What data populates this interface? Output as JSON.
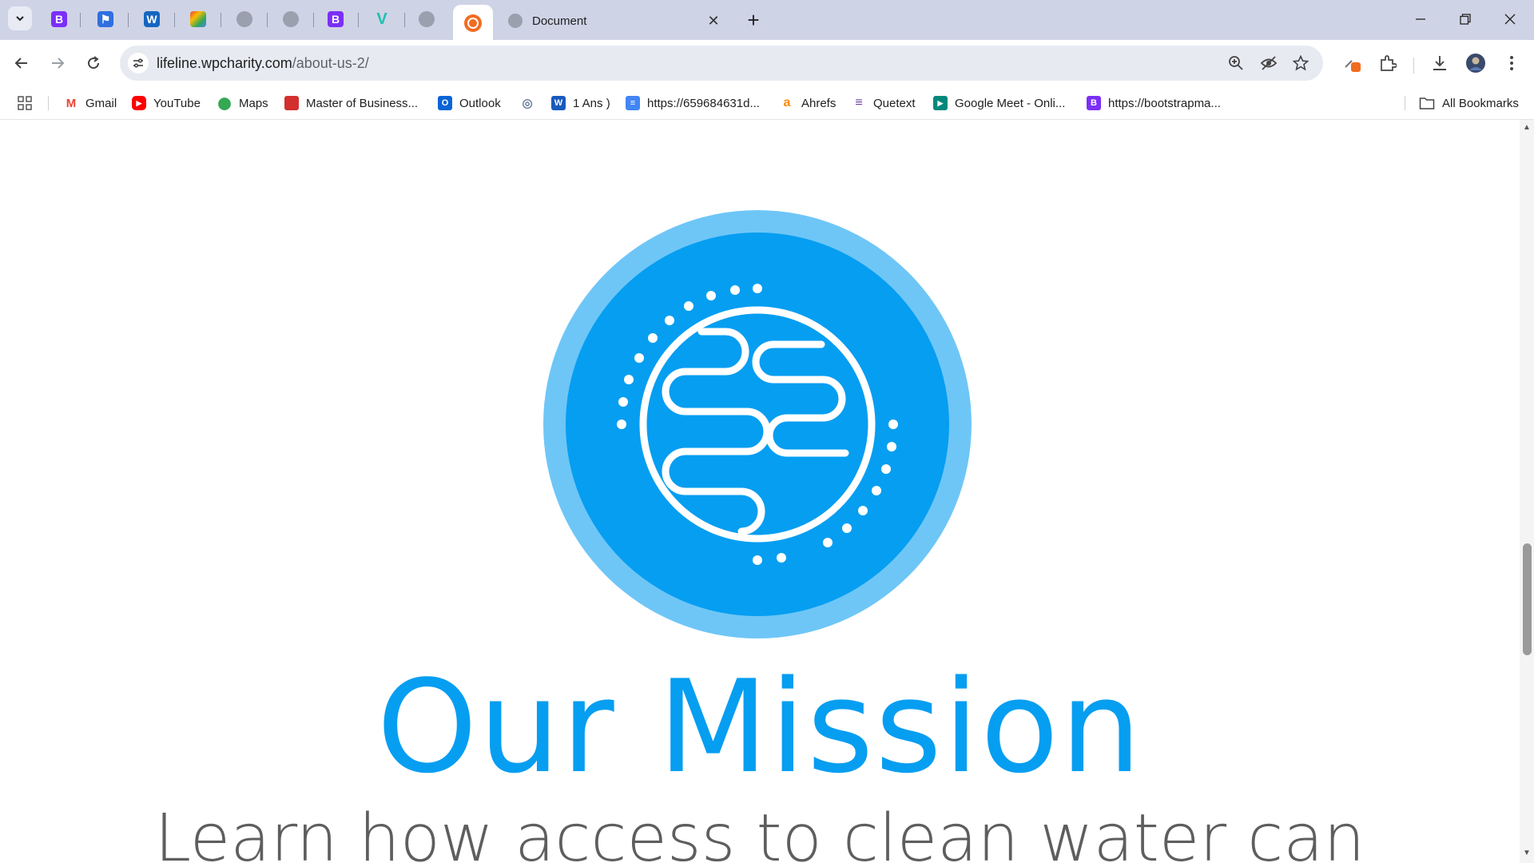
{
  "browser": {
    "tabs": [
      {
        "icon": "bootstrap-icon",
        "letter": "B",
        "color": "#7b2ff7"
      },
      {
        "icon": "flag-icon",
        "letter": "⚑",
        "color": "#2f6fe0"
      },
      {
        "icon": "w-app-icon",
        "letter": "W",
        "color": "#1565c0"
      },
      {
        "icon": "puzzle-color-icon",
        "letter": "✱",
        "color": "#e8590c"
      },
      {
        "icon": "globe-icon",
        "letter": "",
        "color": "#9aa0ad"
      },
      {
        "icon": "globe-icon",
        "letter": "",
        "color": "#9aa0ad"
      },
      {
        "icon": "bootstrap-icon",
        "letter": "B",
        "color": "#7b2ff7"
      },
      {
        "icon": "vuetify-icon",
        "letter": "V",
        "color": "#1ec0b0"
      },
      {
        "icon": "globe-icon",
        "letter": "",
        "color": "#9aa0ad"
      }
    ],
    "active_tab_icon": "wpcharity-icon",
    "document_tab_title": "Document",
    "new_tab_symbol": "+",
    "url_domain": "lifeline.wpcharity.com",
    "url_path": "/about-us-2/",
    "bookmarks": [
      {
        "label": "Gmail",
        "icon": "gmail-icon",
        "color": "#ea4335",
        "glyph": "M"
      },
      {
        "label": "YouTube",
        "icon": "youtube-icon",
        "color": "#ff0000",
        "glyph": "▶"
      },
      {
        "label": "Maps",
        "icon": "maps-icon",
        "color": "#34a853",
        "glyph": "◆"
      },
      {
        "label": "Master of Business...",
        "icon": "bookmark-red-icon",
        "color": "#d32f2f",
        "glyph": "■"
      },
      {
        "label": "Outlook",
        "icon": "outlook-icon",
        "color": "#0a64d6",
        "glyph": "O"
      },
      {
        "label": "",
        "icon": "emblem-icon",
        "color": "#6b7aa0",
        "glyph": "◎"
      },
      {
        "label": "1 Ans )",
        "icon": "word-icon",
        "color": "#185abd",
        "glyph": "W"
      },
      {
        "label": "https://659684631d...",
        "icon": "docs-icon",
        "color": "#4285f4",
        "glyph": "≡"
      },
      {
        "label": "Ahrefs",
        "icon": "ahrefs-icon",
        "color": "#ff8800",
        "glyph": "a"
      },
      {
        "label": "Quetext",
        "icon": "quetext-icon",
        "color": "#6a3ea1",
        "glyph": "≡"
      },
      {
        "label": "Google Meet - Onli...",
        "icon": "meet-icon",
        "color": "#00897b",
        "glyph": "▶"
      },
      {
        "label": "https://bootstrapma...",
        "icon": "bootstrap-icon",
        "color": "#7b2ff7",
        "glyph": "B"
      }
    ],
    "all_bookmarks": "All Bookmarks"
  },
  "page": {
    "heading": "Our Mission",
    "subheading": "Learn how access to clean water can",
    "logo_colors": {
      "outer": "#6ec6f7",
      "inner": "#069ef1",
      "lines": "#ffffff"
    }
  }
}
